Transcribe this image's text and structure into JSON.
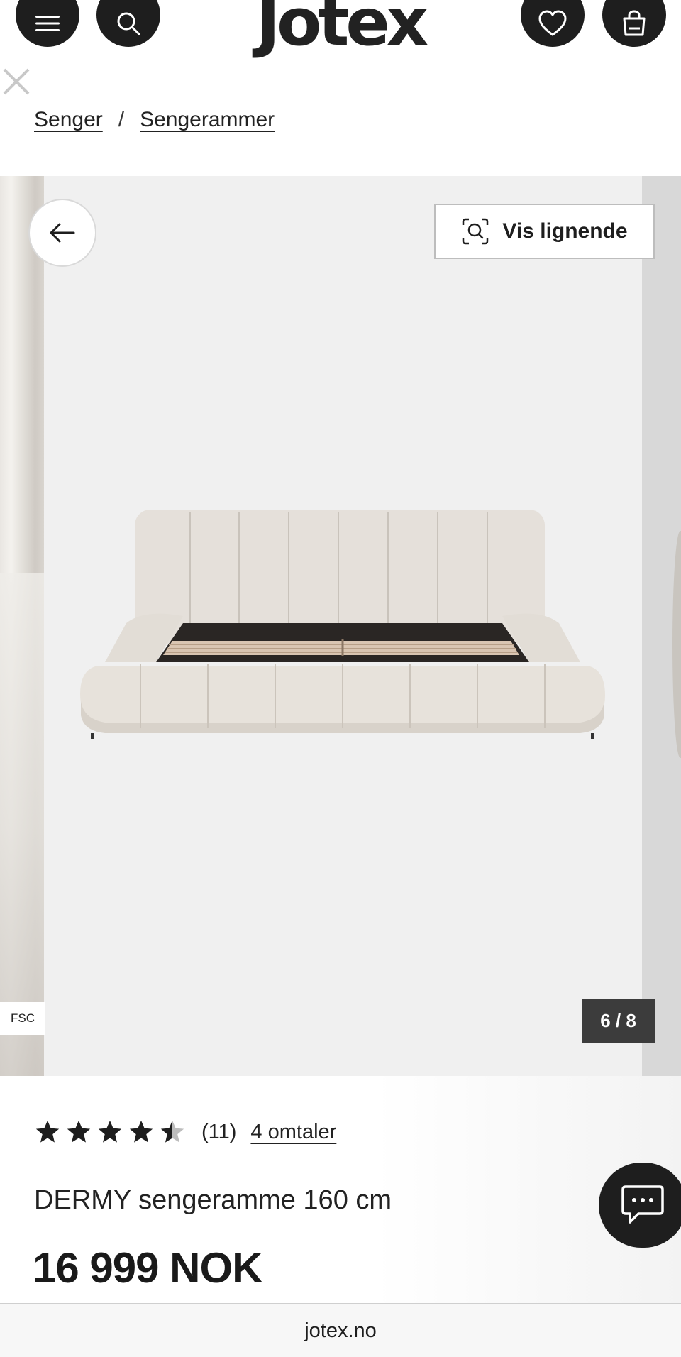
{
  "header": {
    "logo": "Jotex",
    "menu_icon": "hamburger-menu-icon",
    "search_icon": "search-icon",
    "wishlist_icon": "heart-icon",
    "bag_icon": "shopping-bag-icon"
  },
  "breadcrumb": {
    "items": [
      "Senger",
      "Sengerammer"
    ],
    "separator": "/"
  },
  "gallery": {
    "similar_label": "Vis lignende",
    "counter": "6 / 8",
    "badge": "FSC",
    "image_description_icon": "bed-frame-image"
  },
  "product": {
    "rating": 4.5,
    "rating_count": "(11)",
    "reviews_label": "4 omtaler",
    "title": "DERMY sengeramme 160 cm",
    "price": "16 999 NOK"
  },
  "browser": {
    "url": "jotex.no"
  },
  "colors": {
    "dark": "#1e1e1e",
    "gallery_bg": "#f0f0f0",
    "bed": "#e6e1db"
  }
}
